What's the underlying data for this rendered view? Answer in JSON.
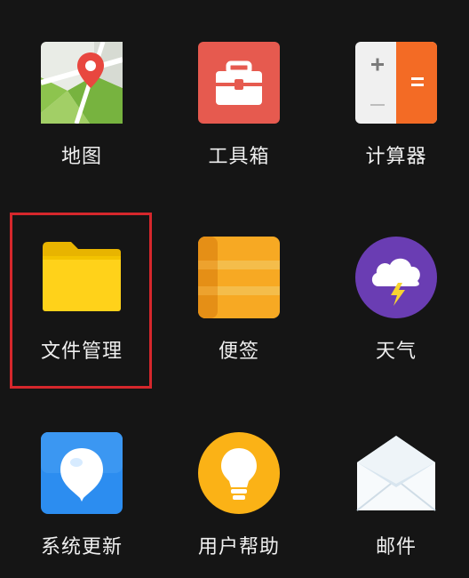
{
  "screen": {
    "apps": [
      {
        "id": "maps",
        "label": "地图",
        "icon": "maps-icon"
      },
      {
        "id": "toolbox",
        "label": "工具箱",
        "icon": "toolbox-icon"
      },
      {
        "id": "calculator",
        "label": "计算器",
        "icon": "calculator-icon"
      },
      {
        "id": "file-manager",
        "label": "文件管理",
        "icon": "folder-icon",
        "highlighted": true
      },
      {
        "id": "notes",
        "label": "便签",
        "icon": "notes-icon"
      },
      {
        "id": "weather",
        "label": "天气",
        "icon": "weather-icon"
      },
      {
        "id": "system-update",
        "label": "系统更新",
        "icon": "system-update-icon"
      },
      {
        "id": "help",
        "label": "用户帮助",
        "icon": "lightbulb-icon"
      },
      {
        "id": "mail",
        "label": "邮件",
        "icon": "mail-icon"
      }
    ],
    "highlight_color": "#d5272c"
  }
}
